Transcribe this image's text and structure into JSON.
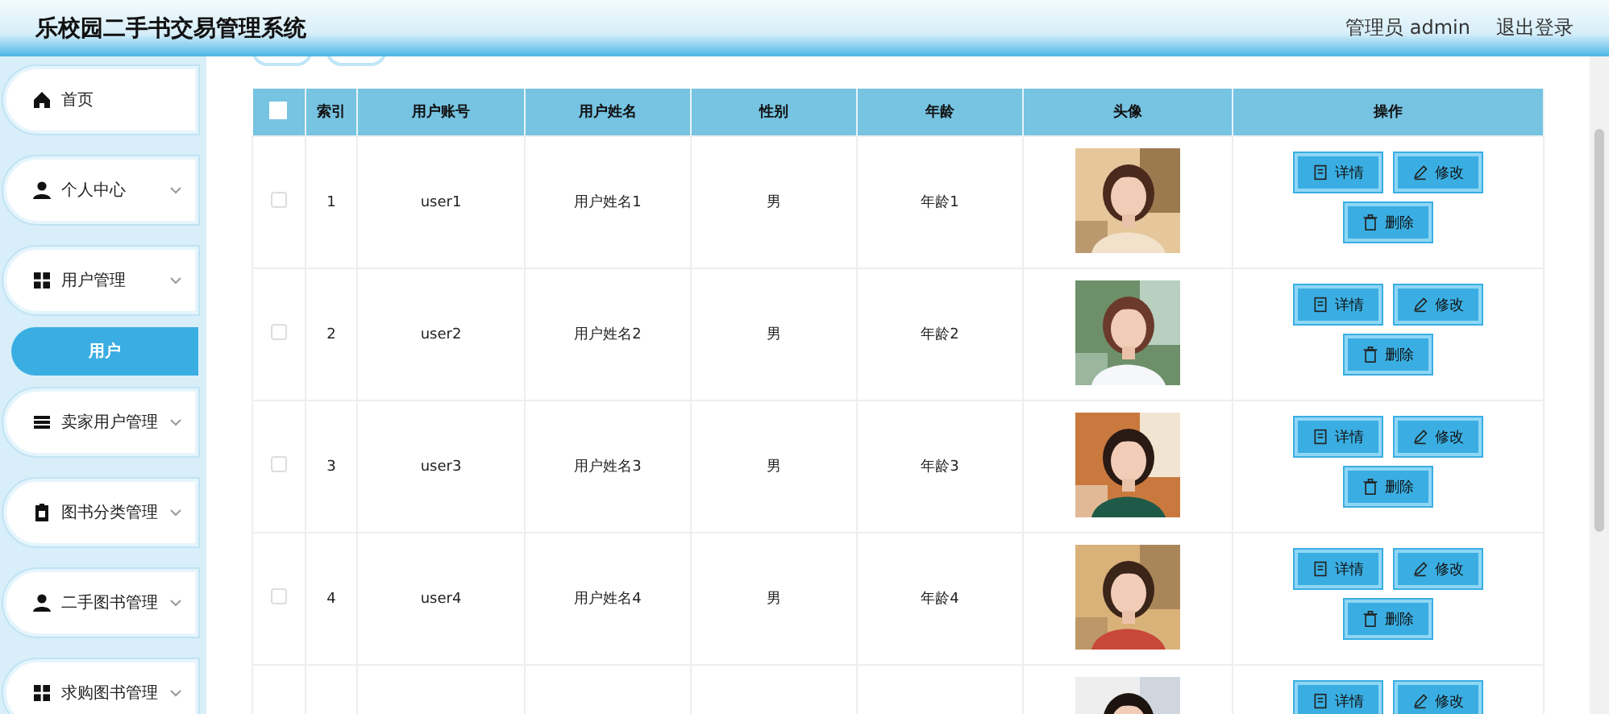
{
  "header": {
    "title": "乐校园二手书交易管理系统",
    "user": "管理员 admin",
    "logout": "退出登录"
  },
  "sidebar": {
    "items": [
      {
        "label": "首页",
        "expandable": false,
        "selected": false,
        "kind": "menu"
      },
      {
        "label": "个人中心",
        "expandable": true,
        "selected": false,
        "kind": "menu"
      },
      {
        "label": "用户管理",
        "expandable": true,
        "selected": false,
        "kind": "menu"
      },
      {
        "label": "用户",
        "selected": true,
        "kind": "sub"
      },
      {
        "label": "卖家用户管理",
        "expandable": true,
        "selected": false,
        "kind": "menu"
      },
      {
        "label": "图书分类管理",
        "expandable": true,
        "selected": false,
        "kind": "menu"
      },
      {
        "label": "二手图书管理",
        "expandable": true,
        "selected": false,
        "kind": "menu"
      },
      {
        "label": "求购图书管理",
        "expandable": true,
        "selected": false,
        "kind": "menu"
      }
    ]
  },
  "table": {
    "columns": [
      "索引",
      "用户账号",
      "用户姓名",
      "性别",
      "年龄",
      "头像",
      "操作"
    ],
    "select_all_checked": false,
    "rows": [
      {
        "checked": false,
        "index": "1",
        "account": "user1",
        "name": "用户姓名1",
        "gender": "男",
        "age": "年龄1",
        "avatar": {
          "kind": "picture"
        },
        "actions": [
          "详情",
          "修改",
          "删除"
        ]
      },
      {
        "checked": false,
        "index": "2",
        "account": "user2",
        "name": "用户姓名2",
        "gender": "男",
        "age": "年龄2",
        "avatar": {
          "kind": "picture"
        },
        "actions": [
          "详情",
          "修改",
          "删除"
        ]
      },
      {
        "checked": false,
        "index": "3",
        "account": "user3",
        "name": "用户姓名3",
        "gender": "男",
        "age": "年龄3",
        "avatar": {
          "kind": "picture"
        },
        "actions": [
          "详情",
          "修改",
          "删除"
        ]
      },
      {
        "checked": false,
        "index": "4",
        "account": "user4",
        "name": "用户姓名4",
        "gender": "男",
        "age": "年龄4",
        "avatar": {
          "kind": "picture"
        },
        "actions": [
          "详情",
          "修改",
          "删除"
        ]
      },
      {
        "avatar": {
          "kind": "picture"
        },
        "actions": [
          "详情",
          "修改"
        ]
      }
    ]
  }
}
